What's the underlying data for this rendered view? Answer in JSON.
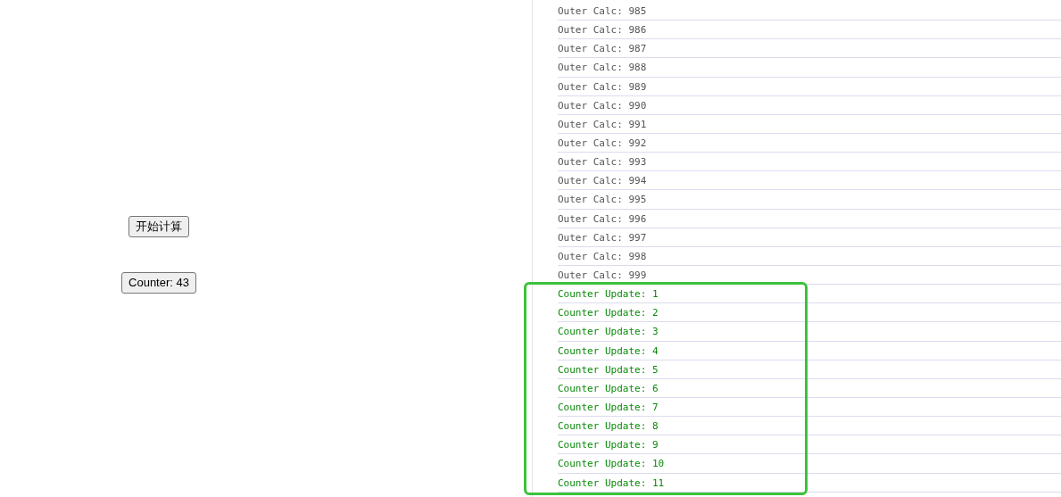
{
  "page": {
    "buttons": [
      {
        "label": "开始计算"
      },
      {
        "label": "Counter: 43"
      }
    ]
  },
  "console": {
    "groups": [
      {
        "kind": "log",
        "highlighted": false,
        "lines": [
          "Outer Calc: 985",
          "Outer Calc: 986",
          "Outer Calc: 987",
          "Outer Calc: 988",
          "Outer Calc: 989",
          "Outer Calc: 990",
          "Outer Calc: 991",
          "Outer Calc: 992",
          "Outer Calc: 993",
          "Outer Calc: 994",
          "Outer Calc: 995",
          "Outer Calc: 996",
          "Outer Calc: 997",
          "Outer Calc: 998",
          "Outer Calc: 999"
        ]
      },
      {
        "kind": "update",
        "highlighted": true,
        "lines": [
          "Counter Update: 1",
          "Counter Update: 2",
          "Counter Update: 3",
          "Counter Update: 4",
          "Counter Update: 5",
          "Counter Update: 6",
          "Counter Update: 7",
          "Counter Update: 8",
          "Counter Update: 9",
          "Counter Update: 10",
          "Counter Update: 11"
        ]
      }
    ]
  }
}
